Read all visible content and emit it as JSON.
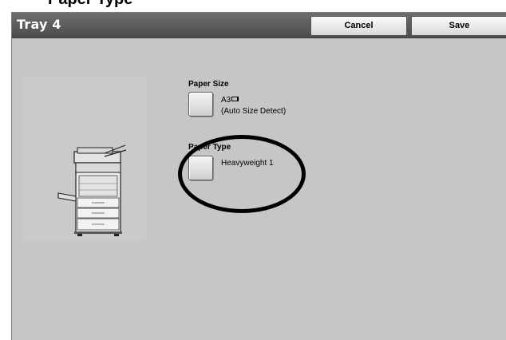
{
  "page": {
    "caption": "Paper Type"
  },
  "header": {
    "title": "Tray 4",
    "cancel_label": "Cancel",
    "save_label": "Save"
  },
  "settings": {
    "paper_size": {
      "label": "Paper Size",
      "value": "A3",
      "value_icon": "long-edge-feed-icon",
      "detail": "(Auto Size Detect)"
    },
    "paper_type": {
      "label": "Paper Type",
      "value": "Heavyweight 1"
    }
  },
  "illustration": {
    "icon": "printer-icon"
  },
  "colors": {
    "header": "#5a5a5a",
    "panel": "#c6c6c6",
    "annotation": "#000000"
  }
}
